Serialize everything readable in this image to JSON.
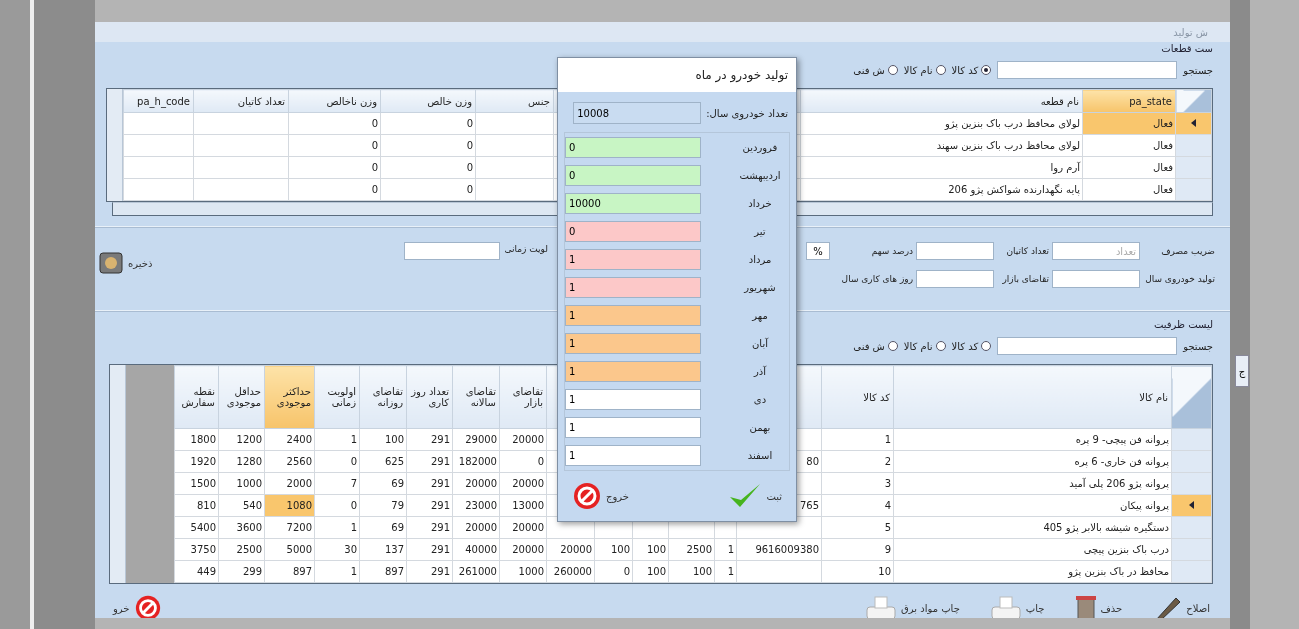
{
  "window": {
    "title": "ش تولید"
  },
  "parts": {
    "title": "ست قطعات",
    "search": {
      "label": "جستجو",
      "options": [
        {
          "label": "کد کالا",
          "selected": true
        },
        {
          "label": "نام کالا",
          "selected": false
        },
        {
          "label": "ش فنی",
          "selected": false
        }
      ]
    },
    "table": {
      "columns": [
        {
          "label": "pa_state",
          "selected": true
        },
        {
          "label": "نام قطعه",
          "selected": false
        },
        {},
        {
          "label": "جنس",
          "selected": false
        },
        {
          "label": "وزن خالص",
          "selected": false
        },
        {
          "label": "وزن ناخالص",
          "selected": false
        },
        {
          "label": "تعداد کاتیان",
          "selected": false
        },
        {
          "label": "pa_h_code",
          "selected": false
        }
      ],
      "rows": [
        {
          "selected": true,
          "cells": [
            "فعال",
            "لولای محافظ درب باک بنزین پژو",
            null,
            null,
            "0",
            "0",
            null,
            null
          ]
        },
        {
          "selected": false,
          "cells": [
            "فعال",
            "لولای محافظ درب باک بنزین سهند",
            null,
            null,
            "0",
            "0",
            null,
            null
          ]
        },
        {
          "selected": false,
          "cells": [
            "فعال",
            "آرم روا",
            null,
            null,
            "0",
            "0",
            null,
            null
          ]
        },
        {
          "selected": false,
          "cells": [
            "فعال",
            "پایه نگهدارنده شواکش پژو 206",
            null,
            null,
            "0",
            "0",
            null,
            null
          ]
        }
      ]
    }
  },
  "form": {
    "fields": [
      {
        "label": "ضریب مصرف",
        "kind": "field",
        "placeholder": "تعداد"
      },
      {
        "label": "تعداد کاتیان",
        "kind": "field"
      },
      {
        "label": "درصد سهم",
        "kind": "field",
        "value": "%"
      },
      {
        "label": "تولید خودروی سال",
        "kind": "field"
      },
      {
        "label": "تقاضای بازار",
        "kind": "field"
      },
      {
        "label": "روز های کاری سال",
        "kind": "label"
      }
    ],
    "priority": {
      "label": "لویت زمانی"
    },
    "save": {
      "label": "ذخیره"
    }
  },
  "capacity": {
    "title": "لیست ظرفیت",
    "search": {
      "label": "جستجو",
      "options": [
        {
          "label": "کد کالا",
          "selected": false
        },
        {
          "label": "نام کالا",
          "selected": false
        },
        {
          "label": "ش فنی",
          "selected": false
        }
      ]
    },
    "table": {
      "columns": [
        {
          "label": "نام کالا",
          "selected": false
        },
        {
          "label": "کد کالا",
          "selected": false
        },
        {},
        {},
        {},
        {},
        {},
        {},
        {
          "label": "تقاضای بازار",
          "selected": false
        },
        {
          "label": "تقاضای سالانه",
          "selected": false
        },
        {
          "label": "تعداد روز کاری",
          "selected": false
        },
        {
          "label": "تقاضای روزانه",
          "selected": false
        },
        {
          "label": "اولویت زمانی",
          "selected": false
        },
        {
          "label": "حداکثر موجودی",
          "selected": true
        },
        {
          "label": "حداقل موجودی",
          "selected": false
        },
        {
          "label": "نقطه سفارش",
          "selected": false
        }
      ],
      "rows": [
        {
          "selected": false,
          "cells": [
            "پروانه فن پیچی- 9 پره",
            "1",
            null,
            null,
            null,
            null,
            null,
            null,
            "20000",
            "29000",
            "291",
            "100",
            "1",
            "2400",
            "1200",
            "1800"
          ]
        },
        {
          "selected": false,
          "cells": [
            "پروانه فن خاری- 6 پره",
            "2",
            "80",
            null,
            null,
            null,
            null,
            null,
            "0",
            "182000",
            "291",
            "625",
            "0",
            "2560",
            "1280",
            "1920"
          ]
        },
        {
          "selected": false,
          "cells": [
            "پروانه پژو 206 پلی آمید",
            "3",
            null,
            null,
            null,
            null,
            null,
            null,
            "20000",
            "20000",
            "291",
            "69",
            "7",
            "2000",
            "1000",
            "1500"
          ]
        },
        {
          "selected": true,
          "cells": [
            "پروانه پیکان",
            "4",
            "765",
            null,
            null,
            null,
            null,
            null,
            "13000",
            "23000",
            "291",
            "79",
            "0",
            "1080",
            "540",
            "810"
          ]
        },
        {
          "selected": false,
          "cells": [
            "دستگیره شیشه بالابر پژو 405",
            "5",
            null,
            null,
            null,
            null,
            null,
            null,
            "20000",
            "20000",
            "291",
            "69",
            "1",
            "7200",
            "3600",
            "5400"
          ]
        },
        {
          "selected": false,
          "cells": [
            "درب باک بنزین پیچی",
            "9",
            "9616009380",
            "1",
            "2500",
            "100",
            "100",
            "20000",
            "20000",
            "40000",
            "291",
            "137",
            "30",
            "5000",
            "2500",
            "3750"
          ]
        },
        {
          "selected": false,
          "cells": [
            "محافظ در باک بنزین پژو",
            "10",
            null,
            "1",
            "100",
            "100",
            "0",
            "260000",
            "1000",
            "261000",
            "291",
            "897",
            "1",
            "897",
            "299",
            "449"
          ]
        }
      ]
    }
  },
  "toolbar": {
    "buttons": [
      {
        "label": "اصلاح",
        "kind": "edit"
      },
      {
        "label": "حذف",
        "kind": "delete"
      },
      {
        "label": "چاپ",
        "kind": "print"
      },
      {
        "label": "چاپ مواد برق",
        "kind": "print"
      }
    ],
    "exit": {
      "label": "خرو"
    }
  },
  "side_tab": {
    "label": "ج"
  },
  "dialog": {
    "title": "تولید خودرو در ماه",
    "total": {
      "label": "تعداد خودروی سال:",
      "value": "10008"
    },
    "months": [
      {
        "label": "فروردین",
        "value": "0",
        "color": "#c8f5c4"
      },
      {
        "label": "اردیبهشت",
        "value": "0",
        "color": "#c8f5c4"
      },
      {
        "label": "خرداد",
        "value": "10000",
        "color": "#c8f5c4"
      },
      {
        "label": "تیر",
        "value": "0",
        "color": "#fcc8c8"
      },
      {
        "label": "مرداد",
        "value": "1",
        "color": "#fcc8c8"
      },
      {
        "label": "شهریور",
        "value": "1",
        "color": "#fcc8c8"
      },
      {
        "label": "مهر",
        "value": "1",
        "color": "#fbc78c"
      },
      {
        "label": "آبان",
        "value": "1",
        "color": "#fbc78c"
      },
      {
        "label": "آذر",
        "value": "1",
        "color": "#fbc78c"
      },
      {
        "label": "دی",
        "value": "1",
        "color": "#ffffff"
      },
      {
        "label": "بهمن",
        "value": "1",
        "color": "#ffffff"
      },
      {
        "label": "اسفند",
        "value": "1",
        "color": "#ffffff"
      }
    ],
    "ok": {
      "label": "ثبت"
    },
    "exit": {
      "label": "خروج"
    }
  }
}
